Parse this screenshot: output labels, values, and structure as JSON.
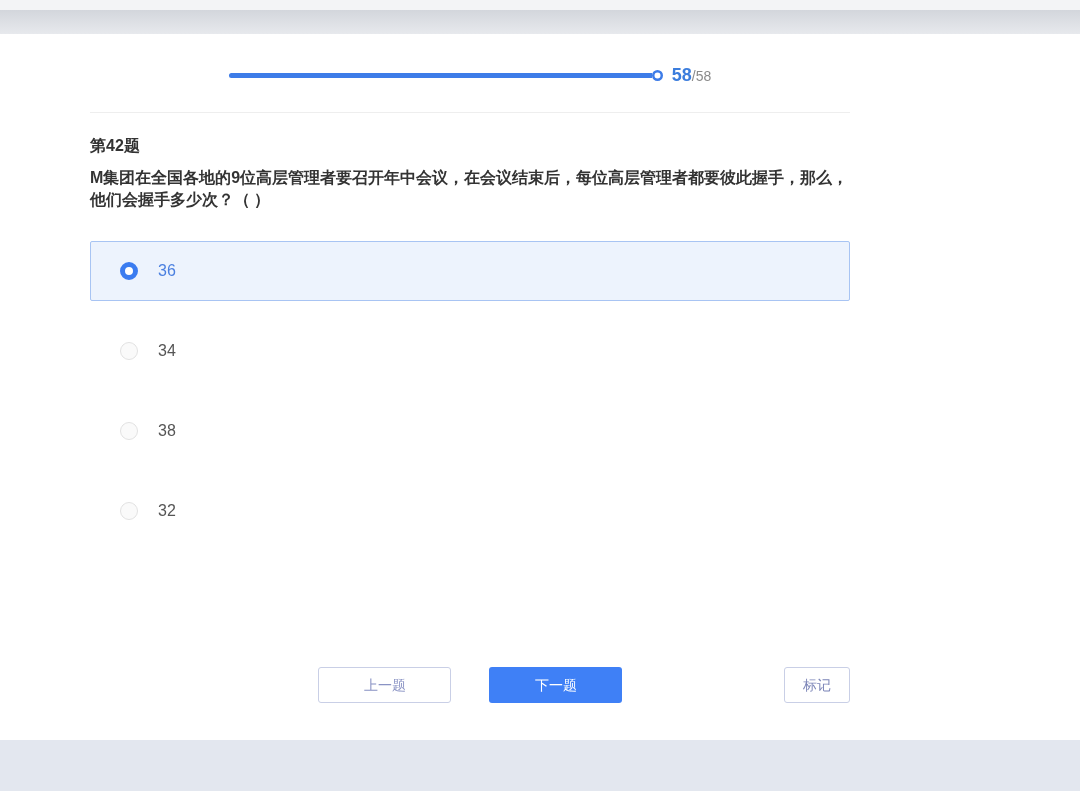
{
  "progress": {
    "level": 1,
    "current": "58",
    "total": "/58"
  },
  "question": {
    "number": "第42题",
    "text": "M集团在全国各地的9位高层管理者要召开年中会议，在会议结束后，每位高层管理者都要彼此握手，那么，他们会握手多少次？（ ）"
  },
  "options": [
    {
      "label": "36",
      "selected": true
    },
    {
      "label": "34",
      "selected": false
    },
    {
      "label": "38",
      "selected": false
    },
    {
      "label": "32",
      "selected": false
    }
  ],
  "buttons": {
    "previous": "上一题",
    "next": "下一题",
    "mark": "标记"
  }
}
